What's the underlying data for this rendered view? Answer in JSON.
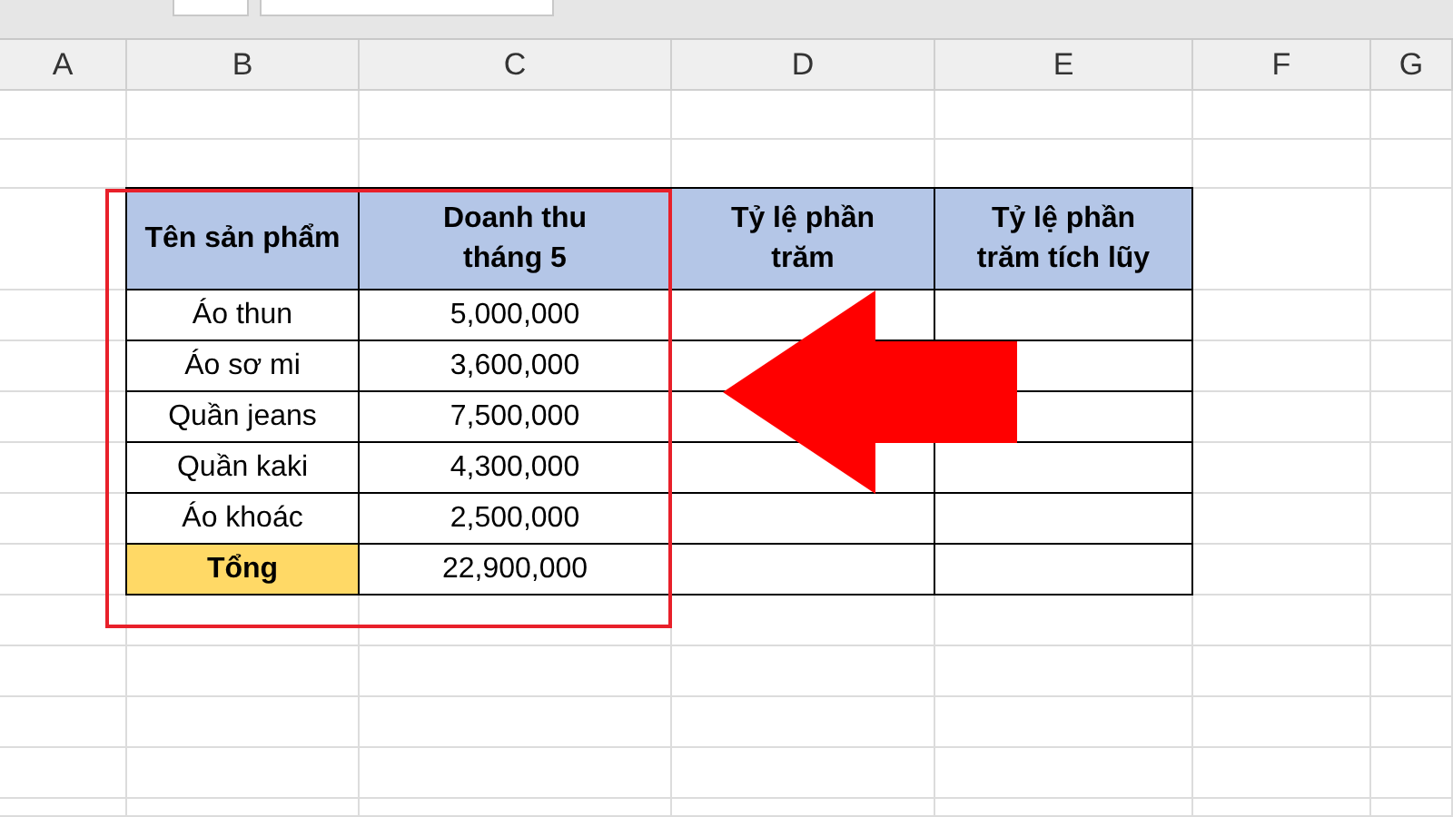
{
  "column_headers": [
    "A",
    "B",
    "C",
    "D",
    "E",
    "F",
    "G"
  ],
  "table": {
    "columns": [
      {
        "label": "Tên sản phẩm"
      },
      {
        "label": "Doanh thu tháng 5"
      },
      {
        "label": "Tỷ lệ phần trăm"
      },
      {
        "label": "Tỷ lệ phần trăm tích lũy"
      }
    ],
    "rows": [
      {
        "product": "Áo thun",
        "revenue": "5,000,000",
        "highlighted": false
      },
      {
        "product": "Áo sơ mi",
        "revenue": "3,600,000",
        "highlighted": false
      },
      {
        "product": "Quần jeans",
        "revenue": "7,500,000",
        "highlighted": false
      },
      {
        "product": "Quần kaki",
        "revenue": "4,300,000",
        "highlighted": false
      },
      {
        "product": "Áo khoác",
        "revenue": "2,500,000",
        "highlighted": false
      },
      {
        "product": "Tổng",
        "revenue": "22,900,000",
        "highlighted": true
      }
    ]
  }
}
